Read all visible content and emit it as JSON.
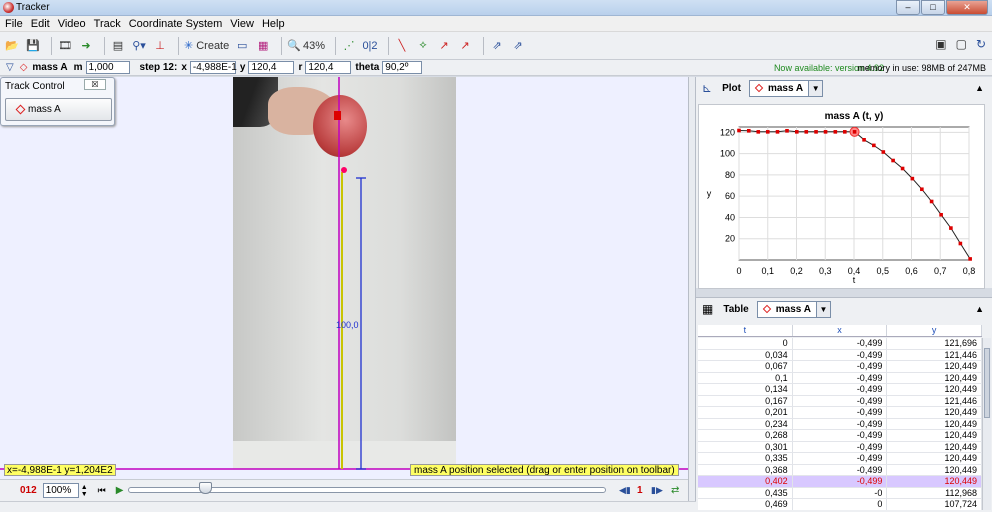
{
  "window": {
    "title": "Tracker"
  },
  "menu": [
    "File",
    "Edit",
    "Video",
    "Track",
    "Coordinate System",
    "View",
    "Help"
  ],
  "toolbar": {
    "create_label": "Create",
    "zoom": "43%",
    "step_label": "0|2"
  },
  "trackbar": {
    "track": "mass A",
    "m_label": "m",
    "m_value": "1,000",
    "step_label": "step 12:",
    "x_label": "x",
    "x_value": "-4,988E-1",
    "y_label": "y",
    "y_value": "120,4",
    "r_label": "r",
    "r_value": "120,4",
    "theta_label": "theta",
    "theta_value": "90,2º",
    "available": "Now available: version 4.92",
    "memory": "memory in use: 98MB of 247MB"
  },
  "track_control": {
    "title": "Track Control",
    "close": "☒",
    "button": "mass A"
  },
  "video": {
    "measure_label": "100,0",
    "coord_readout": "x=-4,988E-1  y=1,204E2",
    "status": "mass A position selected (drag or enter position on toolbar)"
  },
  "player": {
    "frame": "012",
    "zoom": "100%",
    "step": "1"
  },
  "plot": {
    "tab_label": "Plot",
    "track": "mass A"
  },
  "chart_data": {
    "type": "line",
    "title": "mass A (t, y)",
    "xlabel": "t",
    "ylabel": "y",
    "xlim": [
      0,
      0.8
    ],
    "ylim": [
      0,
      125
    ],
    "xticks": [
      "0",
      "0,1",
      "0,2",
      "0,3",
      "0,4",
      "0,5",
      "0,6",
      "0,7",
      "0,8"
    ],
    "yticks": [
      "20",
      "40",
      "60",
      "80",
      "100",
      "120"
    ],
    "x": [
      0,
      0.034,
      0.067,
      0.1,
      0.134,
      0.167,
      0.201,
      0.234,
      0.268,
      0.301,
      0.335,
      0.368,
      0.402,
      0.435,
      0.469,
      0.502,
      0.536,
      0.569,
      0.603,
      0.636,
      0.67,
      0.703,
      0.737,
      0.77,
      0.804
    ],
    "y": [
      121.696,
      121.446,
      120.449,
      120.449,
      120.449,
      121.446,
      120.449,
      120.449,
      120.449,
      120.449,
      120.449,
      120.449,
      120.449,
      112.968,
      107.724,
      101.5,
      93.5,
      86.0,
      76.5,
      66.5,
      55.0,
      42.5,
      30.0,
      15.5,
      1.0
    ],
    "selected_index": 12
  },
  "table": {
    "tab_label": "Table",
    "track": "mass A",
    "columns": [
      "t",
      "x",
      "y"
    ],
    "rows": [
      [
        "0",
        "-0,499",
        "121,696"
      ],
      [
        "0,034",
        "-0,499",
        "121,446"
      ],
      [
        "0,067",
        "-0,499",
        "120,449"
      ],
      [
        "0,1",
        "-0,499",
        "120,449"
      ],
      [
        "0,134",
        "-0,499",
        "120,449"
      ],
      [
        "0,167",
        "-0,499",
        "121,446"
      ],
      [
        "0,201",
        "-0,499",
        "120,449"
      ],
      [
        "0,234",
        "-0,499",
        "120,449"
      ],
      [
        "0,268",
        "-0,499",
        "120,449"
      ],
      [
        "0,301",
        "-0,499",
        "120,449"
      ],
      [
        "0,335",
        "-0,499",
        "120,449"
      ],
      [
        "0,368",
        "-0,499",
        "120,449"
      ],
      [
        "0,402",
        "-0,499",
        "120,449"
      ],
      [
        "0,435",
        "-0",
        "112,968"
      ],
      [
        "0,469",
        "0",
        "107,724"
      ]
    ],
    "selected_row": 12
  }
}
